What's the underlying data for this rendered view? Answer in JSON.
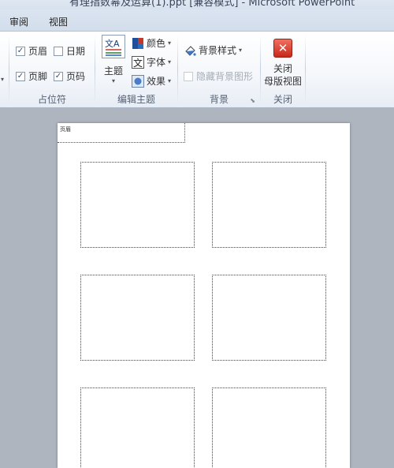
{
  "window": {
    "title": "有理指数幂及运算(1).ppt [兼容模式] - Microsoft PowerPoint"
  },
  "tabs": [
    {
      "label": "审阅"
    },
    {
      "label": "视图"
    }
  ],
  "ribbon": {
    "placeholders": {
      "title": "占位符",
      "header": {
        "label": "页眉",
        "checked": true
      },
      "date": {
        "label": "日期",
        "checked": false
      },
      "footer": {
        "label": "页脚",
        "checked": true
      },
      "page_number": {
        "label": "页码",
        "checked": true
      }
    },
    "edit_theme": {
      "title": "编辑主题",
      "theme_label": "主题",
      "colors_label": "颜色",
      "fonts_label": "字体",
      "effects_label": "效果"
    },
    "background": {
      "title": "背景",
      "styles_label": "背景样式",
      "hide_label": "隐藏背景图形",
      "hide_checked": false
    },
    "close": {
      "title": "关闭",
      "label_line1": "关闭",
      "label_line2": "母版视图"
    }
  },
  "slide": {
    "header_placeholder_text": "页眉",
    "content_placeholders": 6
  }
}
